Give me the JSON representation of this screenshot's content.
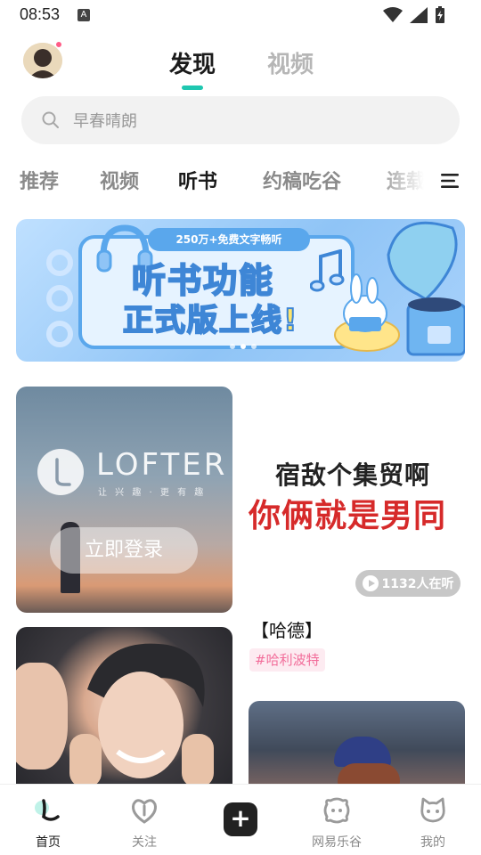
{
  "status_bar": {
    "time": "08:53",
    "notification_letter": "A"
  },
  "header": {
    "tabs": [
      {
        "label": "发现",
        "active": true
      },
      {
        "label": "视频",
        "active": false
      }
    ],
    "accent_color": "#1fc7b0",
    "avatar_badge_color": "#ff5c86"
  },
  "search": {
    "placeholder": "早春晴朗"
  },
  "categories": [
    {
      "label": "推荐",
      "active": false
    },
    {
      "label": "视频",
      "active": false
    },
    {
      "label": "听书",
      "active": true
    },
    {
      "label": "约稿吃谷",
      "active": false
    },
    {
      "label": "连载",
      "active": false
    }
  ],
  "banner": {
    "pill_text": "250万+免费文字畅听",
    "title_line1": "听书功能",
    "title_line2": "正式版上线!",
    "page_count": 3,
    "active_page": 1
  },
  "feed": {
    "lofter_card": {
      "brand": "LOFTER",
      "slogan": "让 兴 趣 · 更 有 趣",
      "login_button": "立即登录"
    },
    "text_card": {
      "line1": "宿敌个集贸啊",
      "line2": "你俩就是男同",
      "listeners": "1132人在听",
      "title": "【哈德】",
      "tag": "#哈利波特",
      "tag_color": "#f26d9a"
    }
  },
  "bottom_nav": [
    {
      "label": "首页",
      "icon": "home-icon",
      "active": true
    },
    {
      "label": "关注",
      "icon": "heart-icon",
      "active": false
    },
    {
      "label": "",
      "icon": "plus-icon",
      "active": false
    },
    {
      "label": "网易乐谷",
      "icon": "lego-face-icon",
      "active": false
    },
    {
      "label": "我的",
      "icon": "profile-face-icon",
      "active": false
    }
  ]
}
